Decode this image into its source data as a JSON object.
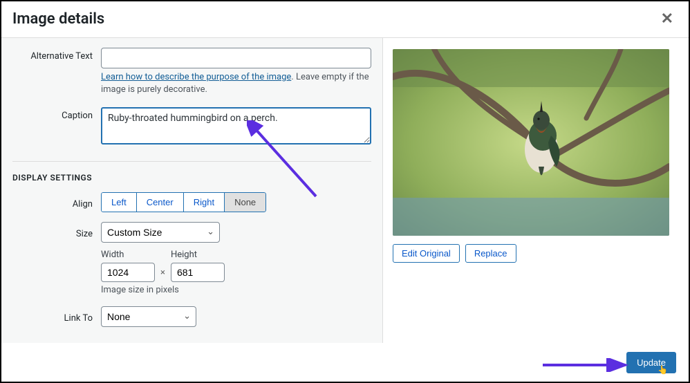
{
  "header": {
    "title": "Image details"
  },
  "form": {
    "alt_label": "Alternative Text",
    "alt_value": "",
    "alt_help_link": "Learn how to describe the purpose of the image",
    "alt_help_tail": ". Leave empty if the image is purely decorative.",
    "caption_label": "Caption",
    "caption_value": "Ruby-throated hummingbird on a perch."
  },
  "display": {
    "section": "DISPLAY SETTINGS",
    "align_label": "Align",
    "align_options": [
      "Left",
      "Center",
      "Right",
      "None"
    ],
    "align_selected": "None",
    "size_label": "Size",
    "size_value": "Custom Size",
    "width_label": "Width",
    "width_value": "1024",
    "height_label": "Height",
    "height_value": "681",
    "size_note": "Image size in pixels",
    "link_label": "Link To",
    "link_value": "None"
  },
  "preview": {
    "edit_label": "Edit Original",
    "replace_label": "Replace"
  },
  "footer": {
    "update_label": "Update"
  }
}
